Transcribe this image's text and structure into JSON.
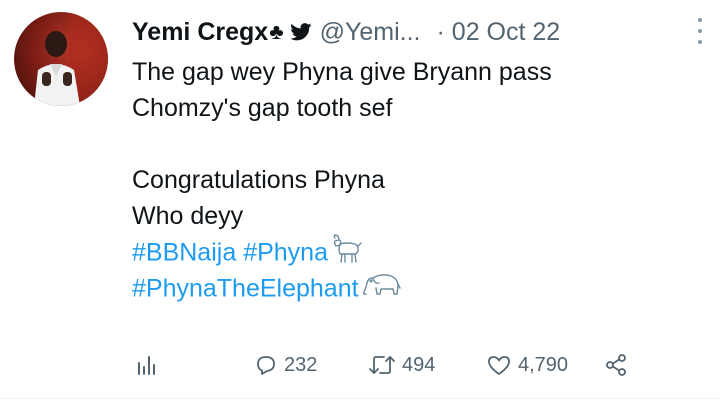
{
  "tweet": {
    "display_name": "Yemi Cregx",
    "name_emoji": "♣",
    "handle": "@Yemi...",
    "date": "· 02 Oct 22",
    "lines": [
      "The gap wey Phyna give Bryann pass",
      "Chomzy's gap tooth sef",
      "",
      "Congratulations Phyna",
      "Who deyy"
    ],
    "hashtags": {
      "bbnaija": "#BBNaija",
      "phyna": "#Phyna",
      "phyna_the_elephant": "#PhynaTheElephant"
    },
    "icons": {
      "verified_bird": "twitter-bird-icon",
      "goat": "goat-emoji-icon",
      "elephant": "elephant-emoji-icon"
    },
    "actions": {
      "analytics_icon": "analytics-icon",
      "replies": "232",
      "retweets": "494",
      "likes": "4,790",
      "share_icon": "share-icon"
    },
    "colors": {
      "text": "#0f1419",
      "secondary": "#536471",
      "link": "#1d9bf0"
    }
  }
}
